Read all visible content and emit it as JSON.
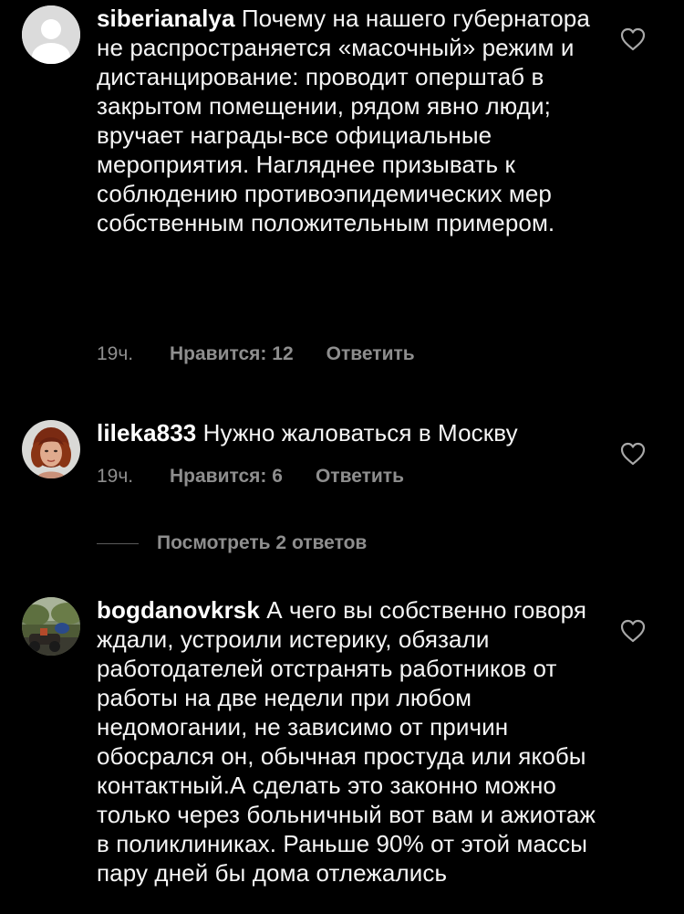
{
  "comments": [
    {
      "username": "siberianalya",
      "text": "Почему на нашего губернатора не распространяется «масочный» режим  и дистанцирование: проводит оперштаб в закрытом помещении, рядом явно люди; вручает награды-все официальные мероприятия. Нагляднее призывать к соблюдению противоэпидемических мер собственным положительным примером.",
      "time": "19ч.",
      "likes": "Нравится: 12",
      "reply": "Ответить",
      "avatar_icon": "default-avatar-icon"
    },
    {
      "username": "lileka833",
      "text": "Нужно жаловаться в Москву",
      "time": "19ч.",
      "likes": "Нравится: 6",
      "reply": "Ответить",
      "avatar_icon": "user-photo-avatar-icon"
    },
    {
      "username": "bogdanovkrsk",
      "text": "А чего вы собственно говоря ждали, устроили истерику, обязали работодателей отстранять работников от работы на две недели при любом недомогании, не зависимо от причин обосрался он, обычная простуда или якобы контактный.А сделать это законно можно только через больничный вот вам и ажиотаж в поликлиниках. Раньше 90% от этой массы пару дней бы дома отлежались",
      "avatar_icon": "landscape-photo-avatar-icon"
    }
  ],
  "view_replies": "Посмотреть 2 ответов",
  "colors": {
    "background": "#000000",
    "text": "#f5f5f5",
    "secondary": "#8e8e8e"
  },
  "icons": {
    "like": "heart-outline-icon"
  }
}
